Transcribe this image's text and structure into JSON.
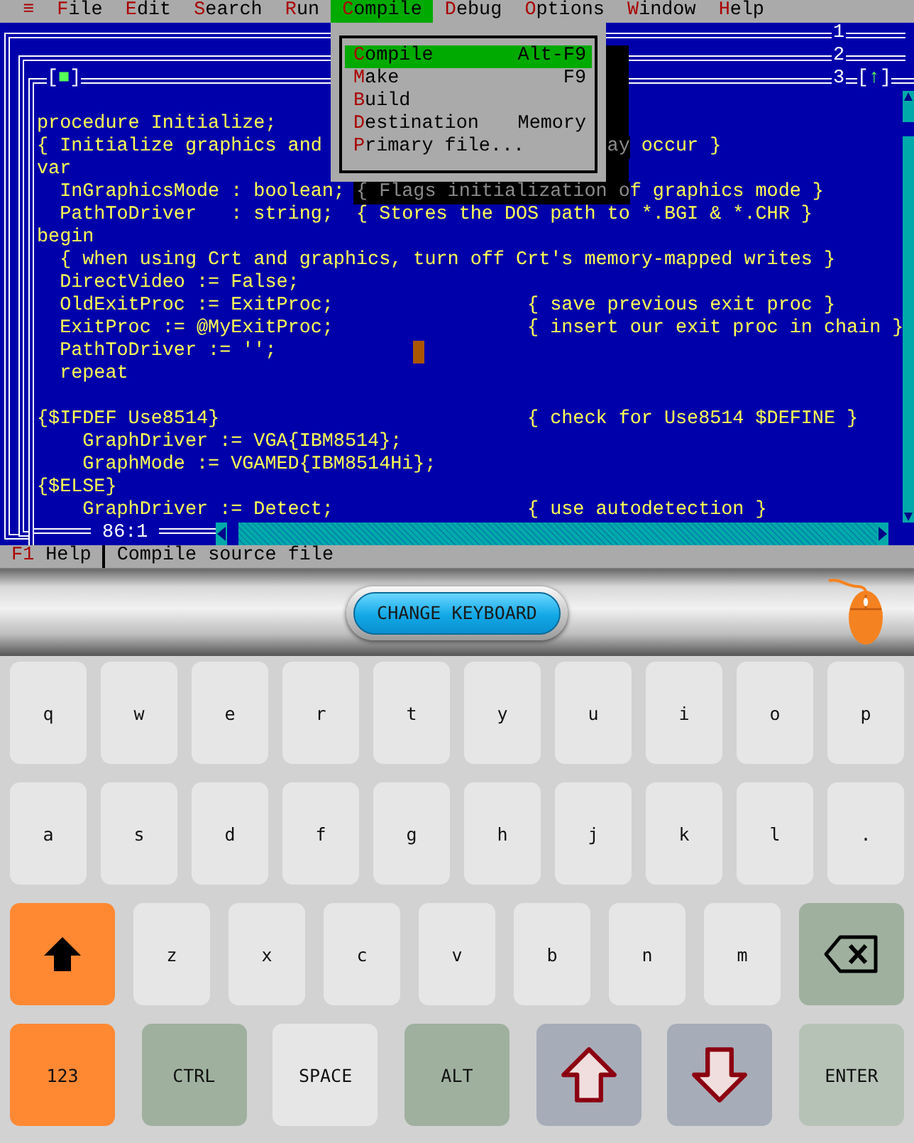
{
  "menu": [
    {
      "label": "≡",
      "selected": false
    },
    {
      "label": "File",
      "selected": false
    },
    {
      "label": "Edit",
      "selected": false
    },
    {
      "label": "Search",
      "selected": false
    },
    {
      "label": "Run",
      "selected": false
    },
    {
      "label": "Compile",
      "selected": true
    },
    {
      "label": "Debug",
      "selected": false
    },
    {
      "label": "Options",
      "selected": false
    },
    {
      "label": "Window",
      "selected": false
    },
    {
      "label": "Help",
      "selected": false
    }
  ],
  "dropdown": [
    {
      "label": "Compile",
      "shortcut": "Alt-F9",
      "selected": true
    },
    {
      "label": "Make",
      "shortcut": "F9",
      "selected": false
    },
    {
      "label": "Build",
      "selected": false
    },
    {
      "label": "Destination",
      "shortcut": "Memory",
      "selected": false
    },
    {
      "label": "Primary file...",
      "selected": false
    }
  ],
  "windows": [
    {
      "number": "1"
    },
    {
      "number": "2"
    }
  ],
  "editor": {
    "close": "[■]",
    "number": "3",
    "zoom": "[↑]",
    "position": "86:1",
    "lines": [
      {
        "code": "procedure Initialize;"
      },
      {
        "code": "{ Initialize graphics and",
        "kind": "edge",
        "shadow": "ay",
        "after": " occur }"
      },
      {
        "code": "var"
      },
      {
        "code": "  InGraphicsMode : boolean;",
        "kind": "bottom",
        "shadow": "{ Flags initialization o",
        "after": "f graphics mode }"
      },
      {
        "code": "  PathToDriver   : string;  { Stores the DOS path to *.BGI & *.CHR }"
      },
      {
        "code": "begin"
      },
      {
        "code": "  { when using Crt and graphics, turn off Crt's memory-mapped writes }"
      },
      {
        "code": "  DirectVideo := False;"
      },
      {
        "code": "  OldExitProc := ExitProc;",
        "comment": "{ save previous exit proc }"
      },
      {
        "code": "  ExitProc := @MyExitProc;",
        "comment": "{ insert our exit proc in chain }"
      },
      {
        "code": "  PathToDriver := '';",
        "cursor": true
      },
      {
        "code": "  repeat"
      },
      {
        "kind": "blank"
      },
      {
        "code": "{$IFDEF Use8514}",
        "comment": "{ check for Use8514 $DEFINE }"
      },
      {
        "code": "    GraphDriver := VGA{IBM8514};"
      },
      {
        "code": "    GraphMode := VGAMED{IBM8514Hi};"
      },
      {
        "code": "{$ELSE}"
      },
      {
        "code": "    GraphDriver := Detect;",
        "comment": "{ use autodetection }"
      }
    ]
  },
  "status_bar": {
    "key": "F1",
    "label": "Help",
    "hint": "Compile source file"
  },
  "keyboard": {
    "title": "CHANGE KEYBOARD",
    "rows": [
      {
        "keys": [
          {
            "kind": "letter",
            "label": "q"
          },
          {
            "kind": "letter",
            "label": "w"
          },
          {
            "kind": "letter",
            "label": "e"
          },
          {
            "kind": "letter",
            "label": "r"
          },
          {
            "kind": "letter",
            "label": "t"
          },
          {
            "kind": "letter",
            "label": "y"
          },
          {
            "kind": "letter",
            "label": "u"
          },
          {
            "kind": "letter",
            "label": "i"
          },
          {
            "kind": "letter",
            "label": "o"
          },
          {
            "kind": "letter",
            "label": "p"
          }
        ]
      },
      {
        "keys": [
          {
            "kind": "letter",
            "label": "a"
          },
          {
            "kind": "letter",
            "label": "s"
          },
          {
            "kind": "letter",
            "label": "d"
          },
          {
            "kind": "letter",
            "label": "f"
          },
          {
            "kind": "letter",
            "label": "g"
          },
          {
            "kind": "letter",
            "label": "h"
          },
          {
            "kind": "letter",
            "label": "j"
          },
          {
            "kind": "letter",
            "label": "k"
          },
          {
            "kind": "letter",
            "label": "l"
          },
          {
            "kind": "letter",
            "label": "."
          }
        ]
      },
      {
        "keys": [
          {
            "kind": "shift"
          },
          {
            "kind": "letter",
            "label": "z"
          },
          {
            "kind": "letter",
            "label": "x"
          },
          {
            "kind": "letter",
            "label": "c"
          },
          {
            "kind": "letter",
            "label": "v"
          },
          {
            "kind": "letter",
            "label": "b"
          },
          {
            "kind": "letter",
            "label": "n"
          },
          {
            "kind": "letter",
            "label": "m"
          },
          {
            "kind": "backspace"
          }
        ]
      },
      {
        "keys": [
          {
            "kind": "orange",
            "label": "123"
          },
          {
            "kind": "mod",
            "label": "CTRL"
          },
          {
            "kind": "space",
            "label": "SPACE"
          },
          {
            "kind": "mod",
            "label": "ALT"
          },
          {
            "kind": "up"
          },
          {
            "kind": "down"
          },
          {
            "kind": "enter",
            "label": "ENTER"
          }
        ]
      }
    ]
  }
}
